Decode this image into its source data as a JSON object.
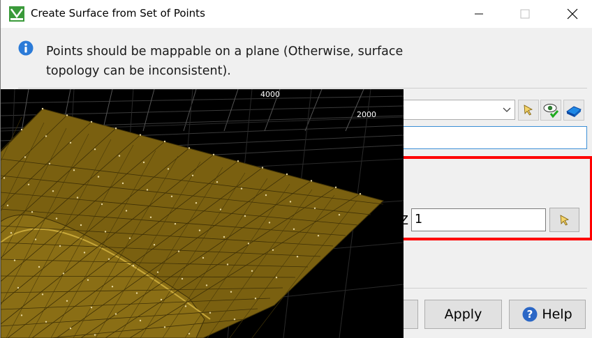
{
  "window": {
    "title": "Create Surface from Set of Points",
    "controls": [
      "minimize",
      "maximize",
      "close"
    ]
  },
  "info": {
    "icon": "info-icon",
    "message": "Points should be mappable on a plane (Otherwise, surface topology can be inconsistent)."
  },
  "form": {
    "z_label": "Z",
    "z_value": "1"
  },
  "viewport": {
    "tick_labels": [
      "4000",
      "2000"
    ]
  },
  "buttons": {
    "apply": "Apply",
    "help": "Help"
  },
  "colors": {
    "surface": "#7a6010",
    "highlight": "#ff0000",
    "focus_border": "#3b8fd6"
  }
}
